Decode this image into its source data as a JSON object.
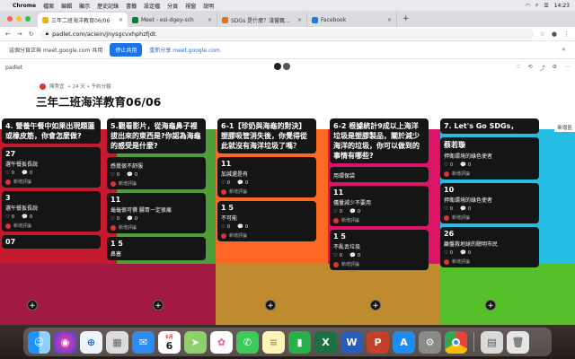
{
  "menubar": {
    "items": [
      "Chrome",
      "檔案",
      "編輯",
      "顯示",
      "歷史記錄",
      "書籤",
      "設定檔",
      "分頁",
      "視窗",
      "說明"
    ],
    "clock": "14:23"
  },
  "tabs": [
    {
      "title": "三年二班海洋教育06/06",
      "color": "#f2b400",
      "active": true
    },
    {
      "title": "Meet - esi-dgey-sch",
      "color": "#00832d",
      "active": false
    },
    {
      "title": "SDGs 是什麼？淺嘗輒止？超越...",
      "color": "#e8710a",
      "active": false
    },
    {
      "title": "Facebook",
      "color": "#1877f2",
      "active": false
    }
  ],
  "address": {
    "url": "padlet.com/aciein/jnysgcvxhphzfjdt"
  },
  "sharebar": {
    "message": "這個分頁正與 meet.google.com 共用",
    "stop": "停止共用",
    "reshare": "重新分享 meet.google.com"
  },
  "padlet": {
    "brand": "padlet",
    "author": "陳秀宜",
    "meta_rest": "• 24 天 • 予約分鐘",
    "title": "三年二班海洋教育06/06",
    "edge_label": "新增區",
    "new_post": "新增評論",
    "columns": [
      {
        "title": "4. 營養午餐中如果出現題蓮或橡皮筋，你會怎麼做?",
        "cards": [
          {
            "big": "27",
            "line": "選午餐扳長說",
            "reacts": [
              "♡ 0",
              "💬 0"
            ]
          },
          {
            "big": "3",
            "line": "選午餐扳長說",
            "reacts": [
              "♡ 0",
              "💬 0"
            ]
          },
          {
            "big": "07",
            "line": "",
            "reacts": []
          }
        ]
      },
      {
        "title": "5.觀看影片，從海龜鼻子裡拔出來的東西是?你認為海龜的感受是什麼?",
        "cards": [
          {
            "big": "",
            "line": "感覺很不舒服",
            "reacts": [
              "♡ 0",
              "💬 0"
            ]
          },
          {
            "big": "11",
            "line": "龜龜很可憐 腸胃一定很痛",
            "reacts": [
              "♡ 0",
              "💬 0"
            ]
          },
          {
            "big": "1 5",
            "line": "鼻塞",
            "reacts": []
          }
        ]
      },
      {
        "title": "6-1【珍奶與海龜的對決】塑膠吸管消失後，你覺得從此就沒有海洋垃圾了嗎？",
        "cards": [
          {
            "big": "11",
            "line": "加減還是有",
            "reacts": [
              "♡ 0",
              "💬 0"
            ]
          },
          {
            "big": "1 5",
            "line": "不可能",
            "reacts": [
              "♡ 0",
              "💬 0"
            ]
          }
        ]
      },
      {
        "title": "6-2 根據統計9成以上海洋垃圾是塑膠製品，關於減少海洋的垃圾，你可以做到的事情有哪些?",
        "cards": [
          {
            "big": "",
            "line": "用環保袋",
            "reacts": []
          },
          {
            "big": "11",
            "line": "儘量減少不要用",
            "reacts": [
              "♡ 0",
              "💬 0"
            ]
          },
          {
            "big": "1 5",
            "line": "不亂丟垃圾",
            "reacts": [
              "♡ 0",
              "💬 0"
            ]
          }
        ]
      },
      {
        "title": "7. Let's Go SDGs，",
        "cards": [
          {
            "big": "蔡若璇",
            "line": "捍衛環境的綠色使者",
            "reacts": [
              "♡ 0",
              "💬 0"
            ]
          },
          {
            "big": "10",
            "line": "捍衛環境的綠色使者",
            "reacts": [
              "♡ 0",
              "💬 0"
            ]
          },
          {
            "big": "26",
            "line": "離盤救地球的聰明市民",
            "reacts": [
              "♡ 0",
              "💬 0"
            ]
          }
        ]
      }
    ]
  },
  "dock": {
    "calendar_month": "6月",
    "calendar_day": "6",
    "apps": [
      "finder",
      "siri",
      "safari",
      "launchpad",
      "mail",
      "calendar",
      "maps",
      "photos",
      "messages",
      "notes",
      "numbers",
      "excel",
      "word",
      "powerpoint",
      "app-store",
      "system-preferences",
      "chrome",
      "downloads",
      "trash"
    ]
  }
}
